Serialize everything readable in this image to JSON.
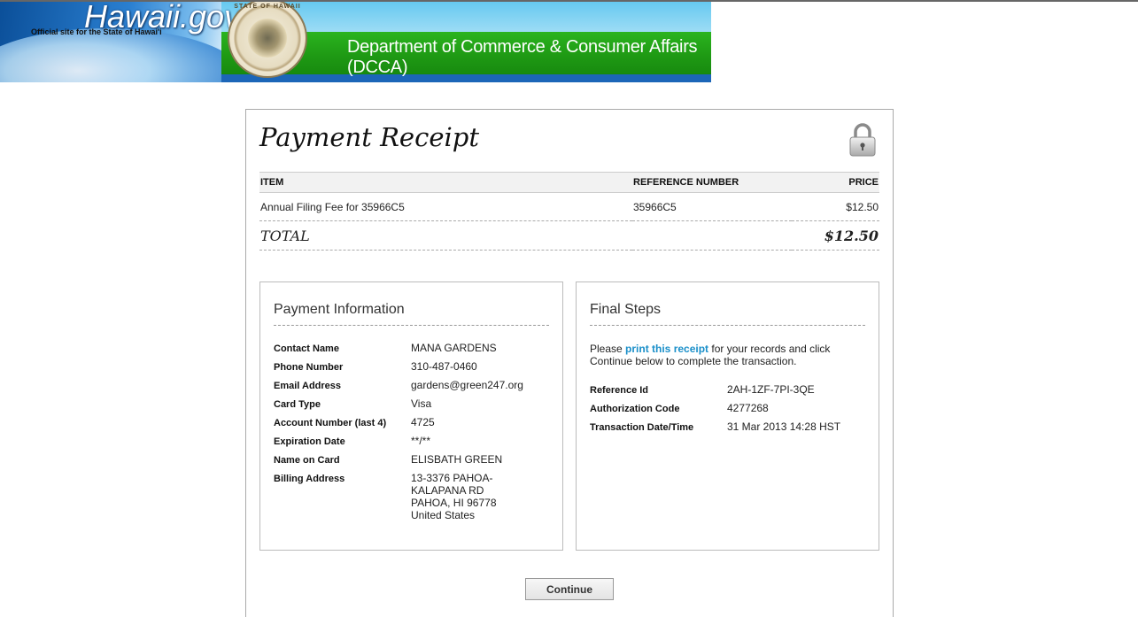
{
  "header": {
    "site_title": "Hawaii.gov",
    "site_subtitle": "Official site for the State of Hawai'i",
    "seal_text": "STATE OF HAWAII",
    "department": "Department of Commerce & Consumer Affairs (DCCA)"
  },
  "receipt": {
    "title": "Payment Receipt",
    "columns": {
      "item": "ITEM",
      "reference": "REFERENCE NUMBER",
      "price": "PRICE"
    },
    "items": [
      {
        "item": "Annual Filing Fee for 35966C5",
        "reference": "35966C5",
        "price": "$12.50"
      }
    ],
    "total_label": "TOTAL",
    "total_value": "$12.50"
  },
  "payment_info": {
    "heading": "Payment Information",
    "contact_name_label": "Contact Name",
    "contact_name": "MANA GARDENS",
    "phone_label": "Phone Number",
    "phone": "310-487-0460",
    "email_label": "Email Address",
    "email": "gardens@green247.org",
    "card_type_label": "Card Type",
    "card_type": "Visa",
    "account_label": "Account Number (last 4)",
    "account": "4725",
    "expiration_label": "Expiration Date",
    "expiration": "**/**",
    "name_on_card_label": "Name on Card",
    "name_on_card": "ELISBATH GREEN",
    "billing_label": "Billing Address",
    "billing_line1": "13-3376 PAHOA-",
    "billing_line2": "KALAPANA RD",
    "billing_line3": "PAHOA, HI 96778",
    "billing_line4": "United States"
  },
  "final_steps": {
    "heading": "Final Steps",
    "text_before": "Please ",
    "link_text": "print this receipt",
    "text_after": " for your records and click Continue below to complete the transaction.",
    "reference_label": "Reference Id",
    "reference": "2AH-1ZF-7PI-3QE",
    "auth_label": "Authorization Code",
    "auth": "4277268",
    "date_label": "Transaction Date/Time",
    "date": "31 Mar 2013 14:28 HST"
  },
  "actions": {
    "continue_label": "Continue"
  },
  "icons": {
    "lock": "lock-icon"
  }
}
